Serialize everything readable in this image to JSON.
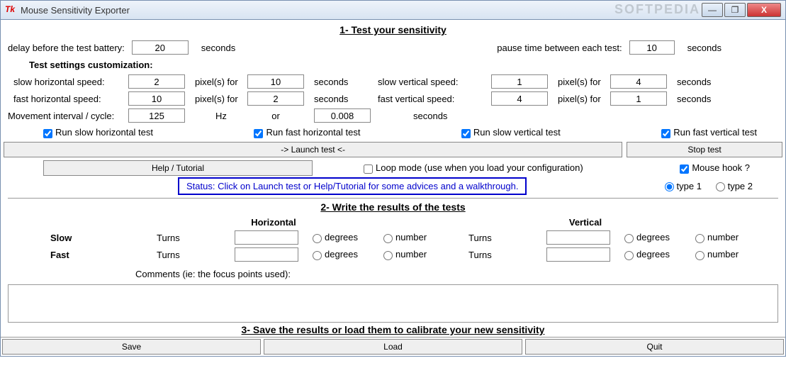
{
  "window": {
    "title": "Mouse Sensitivity Exporter",
    "min": "—",
    "max": "❐",
    "close": "X",
    "watermark": "SOFTPEDIA"
  },
  "s1": {
    "title": "1- Test your sensitivity",
    "delay_label": "delay before the test battery:",
    "delay_value": "20",
    "seconds": "seconds",
    "pause_label": "pause time between each test:",
    "pause_value": "10",
    "settings_label": "Test settings customization:",
    "slow_h_label": "slow horizontal speed:",
    "slow_h_val": "2",
    "fast_h_label": "fast horizontal speed:",
    "fast_h_val": "10",
    "pixels_for": "pixel(s) for",
    "slow_h_sec": "10",
    "fast_h_sec": "2",
    "slow_v_label": "slow vertical speed:",
    "slow_v_val": "1",
    "slow_v_sec": "4",
    "fast_v_label": "fast vertical speed:",
    "fast_v_val": "4",
    "fast_v_sec": "1",
    "movement_label": "Movement interval / cycle:",
    "movement_hz_val": "125",
    "hz": "Hz",
    "or": "or",
    "movement_sec_val": "0.008",
    "run_slow_h": "Run slow horizontal test",
    "run_fast_h": "Run fast horizontal test",
    "run_slow_v": "Run slow vertical test",
    "run_fast_v": "Run fast vertical test",
    "launch": "-> Launch test <-",
    "stop": "Stop test",
    "help": "Help / Tutorial",
    "loop": "Loop mode (use when you load your configuration)",
    "mousehook": "Mouse hook ?",
    "status": "Status: Click on Launch test or Help/Tutorial for some advices and a walkthrough.",
    "type1": "type 1",
    "type2": "type 2"
  },
  "s2": {
    "title": "2- Write the results of the tests",
    "horizontal": "Horizontal",
    "vertical": "Vertical",
    "slow": "Slow",
    "fast": "Fast",
    "turns": "Turns",
    "degrees": "degrees",
    "number": "number",
    "comments": "Comments (ie: the focus points used):"
  },
  "s3": {
    "title": "3- Save the results or load them to calibrate your new sensitivity",
    "save": "Save",
    "load": "Load",
    "quit": "Quit"
  }
}
